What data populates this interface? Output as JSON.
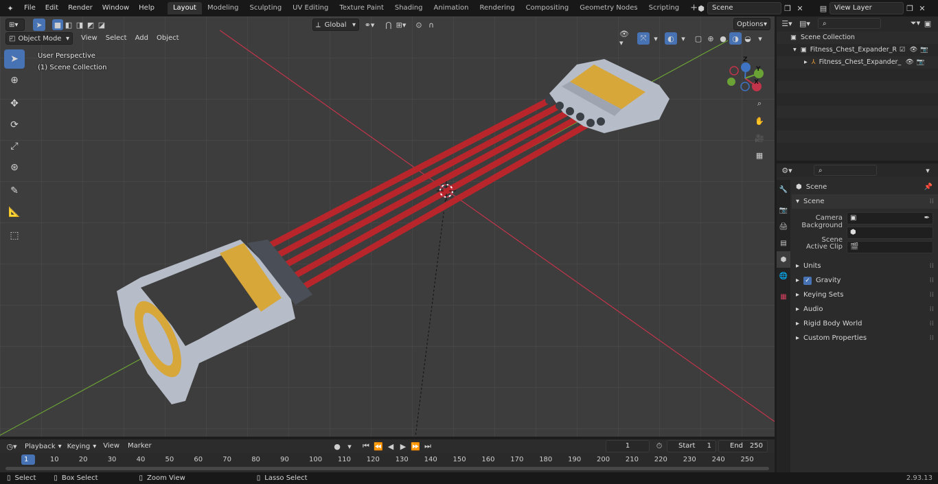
{
  "topbar": {
    "menus": [
      "File",
      "Edit",
      "Render",
      "Window",
      "Help"
    ],
    "workspaces": [
      "Layout",
      "Modeling",
      "Sculpting",
      "UV Editing",
      "Texture Paint",
      "Shading",
      "Animation",
      "Rendering",
      "Compositing",
      "Geometry Nodes",
      "Scripting"
    ],
    "active_workspace": "Layout",
    "scene_label": "Scene",
    "viewlayer_label": "View Layer"
  },
  "viewport": {
    "mode": "Object Mode",
    "menus": [
      "View",
      "Select",
      "Add",
      "Object"
    ],
    "transform_orientation": "Global",
    "options_label": "Options",
    "overlay_line1": "User Perspective",
    "overlay_line2": "(1) Scene Collection",
    "gizmo_axes": [
      "X",
      "Y",
      "Z"
    ]
  },
  "outliner": {
    "root": "Scene Collection",
    "items": [
      {
        "label": "Fitness_Chest_Expander_Red"
      },
      {
        "label": "Fitness_Chest_Expander_"
      }
    ]
  },
  "properties": {
    "context": "Scene",
    "section": "Scene",
    "fields": [
      {
        "label": "Camera",
        "value": ""
      },
      {
        "label": "Background Scene",
        "value": ""
      },
      {
        "label": "Active Clip",
        "value": ""
      }
    ],
    "panels": [
      "Units",
      "Gravity",
      "Keying Sets",
      "Audio",
      "Rigid Body World",
      "Custom Properties"
    ],
    "gravity_checked": true
  },
  "timeline": {
    "menus": [
      "Playback",
      "Keying",
      "View",
      "Marker"
    ],
    "current_frame": "1",
    "start_label": "Start",
    "start_value": "1",
    "end_label": "End",
    "end_value": "250",
    "ruler": [
      "1",
      "10",
      "20",
      "30",
      "40",
      "50",
      "60",
      "70",
      "80",
      "90",
      "100",
      "110",
      "120",
      "130",
      "140",
      "150",
      "160",
      "170",
      "180",
      "190",
      "200",
      "210",
      "220",
      "230",
      "240",
      "250"
    ]
  },
  "statusbar": {
    "hints": [
      "Select",
      "Box Select",
      "Zoom View",
      "Lasso Select"
    ],
    "version": "2.93.13"
  },
  "colors": {
    "accent": "#4772b3",
    "x_axis": "#c2344a",
    "y_axis": "#6ba235",
    "cord": "#b8262c",
    "handle": "#b6bcc8",
    "grip": "#d8a73a"
  }
}
